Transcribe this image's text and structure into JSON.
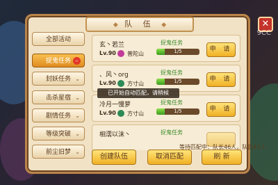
{
  "header": {
    "title": "队 伍",
    "title_deco_left": "◆",
    "title_deco_right": "◆"
  },
  "close_label": "✕",
  "watermark": "9CC",
  "sidebar": {
    "items": [
      {
        "label": "全部活动",
        "active": false
      },
      {
        "label": "捉鬼任务",
        "active": true,
        "badge": "–"
      },
      {
        "label": "封妖任务",
        "arrow": "⌄"
      },
      {
        "label": "击杀星宿",
        "arrow": "⌄"
      },
      {
        "label": "剧情任务",
        "arrow": "⌄"
      },
      {
        "label": "等级突破",
        "arrow": "⌄"
      },
      {
        "label": "前尘旧梦",
        "arrow": "⌄"
      }
    ]
  },
  "teams": [
    {
      "name": "玄丶若兰",
      "level": "Lv.90",
      "school": "普陀山",
      "school_color": "#c23b9a",
      "task": "捉鬼任务",
      "progress": "1/5",
      "progress_value": 0.2,
      "apply": "申 请"
    },
    {
      "name": "、风丶org",
      "level": "Lv.90",
      "school": "方寸山",
      "school_color": "#2e8b57",
      "task": "捉鬼任务",
      "progress": "1/5",
      "progress_value": 0.2,
      "apply": "申 请"
    },
    {
      "name": "冷月一慢萝",
      "level": "Lv.90",
      "school": "方寸山",
      "school_color": "#2e8b57",
      "task": "捉鬼任务",
      "progress": "1/5",
      "progress_value": 0.2,
      "apply": "申 请"
    },
    {
      "name": "相濡以沫丶",
      "level": "",
      "school": "",
      "school_color": "#2e8b57",
      "task": "捉鬼任务",
      "progress": "",
      "progress_value": 0.0,
      "apply": ""
    }
  ],
  "toast": "已开始自动匹配，请稍候",
  "footer": {
    "info": "等待匹配中：队长46人，队员41人",
    "create_team": "创建队伍",
    "cancel_match": "取消匹配",
    "refresh": "刷 新"
  }
}
